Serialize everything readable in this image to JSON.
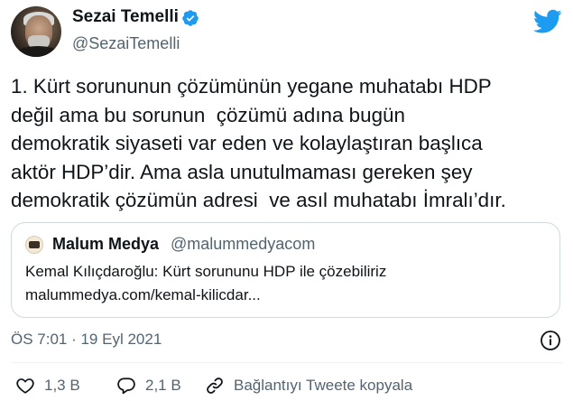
{
  "author": {
    "name": "Sezai Temelli",
    "handle": "@SezaiTemelli",
    "verified": true
  },
  "tweet": {
    "lines": [
      "1. Kürt sorununun çözümünün yegane muhatabı HDP",
      "değil ama bu sorunun  çözümü adına bugün",
      "demokratik siyaseti var eden ve kolaylaştıran başlıca",
      "aktör HDP’dir. Ama asla unutulmaması gereken şey",
      "demokratik çözümün adresi  ve asıl muhatabı İmralı’dır."
    ]
  },
  "quote": {
    "name": "Malum Medya",
    "handle": "@malummedyacom",
    "text_line1": "Kemal Kılıçdaroğlu: Kürt sorununu HDP ile çözebiliriz",
    "text_line2": "malummedya.com/kemal-kilicdar..."
  },
  "meta": {
    "timestamp": "ÖS 7:01 · 19 Eyl 2021"
  },
  "actions": {
    "likes": "1,3 B",
    "replies": "2,1 B",
    "copy_link": "Bağlantıyı Tweete kopyala"
  },
  "icons": {
    "brand": "twitter-bird-icon",
    "verified": "verified-badge-icon",
    "info": "info-icon",
    "like": "heart-icon",
    "reply": "reply-bubble-icon",
    "link": "link-icon"
  },
  "colors": {
    "twitter_blue": "#1d9bf0",
    "text_primary": "#0f1419",
    "text_secondary": "#536471",
    "border": "#cfd9de"
  }
}
